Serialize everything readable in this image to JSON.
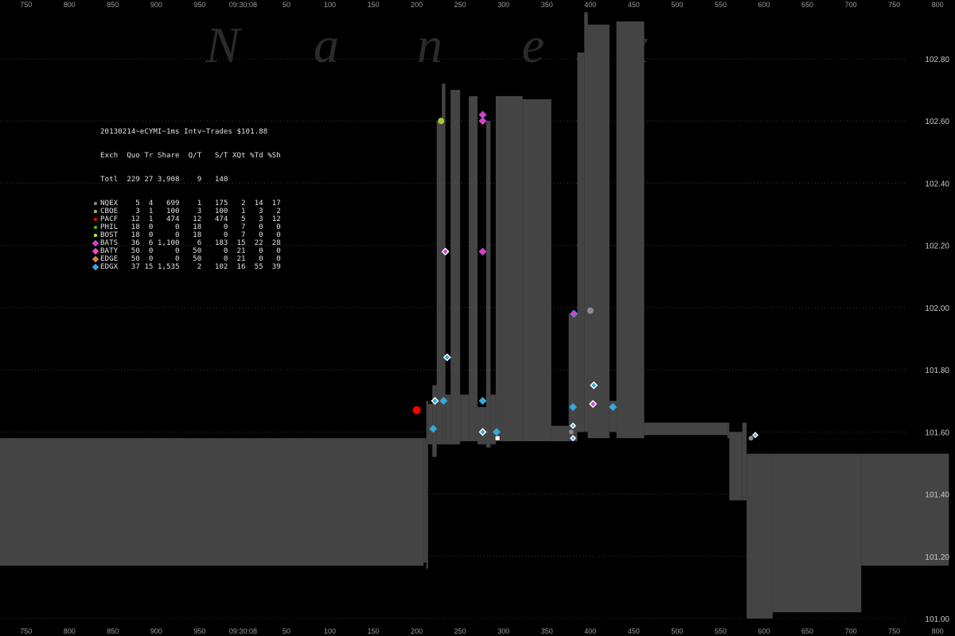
{
  "watermark": "Nanex",
  "chart_data": {
    "type": "area",
    "title": "20130214~eCYMI~1ms Intv~Trades $101.88",
    "ylim": [
      101.0,
      102.92
    ],
    "y_ticks": [
      "102.80",
      "102.60",
      "102.40",
      "102.20",
      "102.00",
      "101.80",
      "101.60",
      "101.40",
      "101.20",
      "101.00"
    ],
    "x_range": [
      720,
      820
    ],
    "x_ticks": [
      "750",
      "800",
      "850",
      "900",
      "950",
      "09:30:08",
      "50",
      "100",
      "150",
      "200",
      "250",
      "300",
      "350",
      "400",
      "450",
      "500",
      "550",
      "600",
      "650",
      "700",
      "750",
      "800"
    ],
    "x_tick_positions": [
      750,
      800,
      850,
      900,
      950,
      1000,
      1050,
      1100,
      1150,
      1200,
      1250,
      1300,
      1350,
      1400,
      1450,
      1500,
      1550,
      1600,
      1650,
      1700,
      1750,
      1800
    ],
    "band": [
      {
        "x0": 720,
        "x1": 1208,
        "low": 101.17,
        "high": 101.58
      },
      {
        "x0": 1208,
        "x1": 1211,
        "low": 101.18,
        "high": 101.58
      },
      {
        "x0": 1211,
        "x1": 1213,
        "low": 101.16,
        "high": 101.7
      },
      {
        "x0": 1213,
        "x1": 1218,
        "low": 101.56,
        "high": 101.69
      },
      {
        "x0": 1218,
        "x1": 1223,
        "low": 101.52,
        "high": 101.75
      },
      {
        "x0": 1223,
        "x1": 1229,
        "low": 101.56,
        "high": 102.6
      },
      {
        "x0": 1229,
        "x1": 1233,
        "low": 101.56,
        "high": 102.72
      },
      {
        "x0": 1233,
        "x1": 1239,
        "low": 101.56,
        "high": 101.72
      },
      {
        "x0": 1239,
        "x1": 1250,
        "low": 101.56,
        "high": 102.7
      },
      {
        "x0": 1250,
        "x1": 1260,
        "low": 101.57,
        "high": 101.72
      },
      {
        "x0": 1260,
        "x1": 1270,
        "low": 101.57,
        "high": 102.68
      },
      {
        "x0": 1270,
        "x1": 1280,
        "low": 101.56,
        "high": 101.68
      },
      {
        "x0": 1280,
        "x1": 1285,
        "low": 101.55,
        "high": 102.6
      },
      {
        "x0": 1285,
        "x1": 1291,
        "low": 101.56,
        "high": 101.72
      },
      {
        "x0": 1291,
        "x1": 1297,
        "low": 101.57,
        "high": 102.68
      },
      {
        "x0": 1297,
        "x1": 1322,
        "low": 101.57,
        "high": 102.68
      },
      {
        "x0": 1322,
        "x1": 1355,
        "low": 101.57,
        "high": 102.67
      },
      {
        "x0": 1355,
        "x1": 1375,
        "low": 101.57,
        "high": 101.62
      },
      {
        "x0": 1375,
        "x1": 1385,
        "low": 101.57,
        "high": 101.98
      },
      {
        "x0": 1385,
        "x1": 1393,
        "low": 101.6,
        "high": 102.82
      },
      {
        "x0": 1393,
        "x1": 1397,
        "low": 101.6,
        "high": 102.95
      },
      {
        "x0": 1397,
        "x1": 1422,
        "low": 101.58,
        "high": 102.91
      },
      {
        "x0": 1422,
        "x1": 1430,
        "low": 101.6,
        "high": 101.7
      },
      {
        "x0": 1430,
        "x1": 1462,
        "low": 101.58,
        "high": 102.92
      },
      {
        "x0": 1462,
        "x1": 1558,
        "low": 101.59,
        "high": 101.63
      },
      {
        "x0": 1558,
        "x1": 1560,
        "low": 101.58,
        "high": 101.63
      },
      {
        "x0": 1560,
        "x1": 1575,
        "low": 101.38,
        "high": 101.6
      },
      {
        "x0": 1575,
        "x1": 1580,
        "low": 101.38,
        "high": 101.63
      },
      {
        "x0": 1580,
        "x1": 1610,
        "low": 101.0,
        "high": 101.53
      },
      {
        "x0": 1610,
        "x1": 1712,
        "low": 101.02,
        "high": 101.53
      },
      {
        "x0": 1712,
        "x1": 1813,
        "low": 101.17,
        "high": 101.53
      }
    ],
    "trades": [
      {
        "exch": "PACF",
        "x": 1200,
        "y": 101.67,
        "shape": "dot",
        "color": "#ff0000",
        "size": 5
      },
      {
        "exch": "CBOE",
        "x": 1228,
        "y": 102.6,
        "shape": "dot",
        "color": "#9acd32",
        "size": 4
      },
      {
        "exch": "BATS",
        "x": 1276,
        "y": 102.62,
        "shape": "diamond",
        "color": "#cc44cc",
        "size": 4
      },
      {
        "exch": "BATS",
        "x": 1276,
        "y": 102.6,
        "shape": "diamond",
        "color": "#cc44cc",
        "size": 4
      },
      {
        "exch": "BATS",
        "x": 1233,
        "y": 102.18,
        "shape": "diamond",
        "color": "#cc44cc",
        "size": 4,
        "outline": true
      },
      {
        "exch": "BATS",
        "x": 1276,
        "y": 102.18,
        "shape": "diamond",
        "color": "#cc44cc",
        "size": 4
      },
      {
        "exch": "EDGX",
        "x": 1381,
        "y": 101.98,
        "shape": "diamond",
        "color": "#33aadd",
        "size": 4
      },
      {
        "exch": "BATS",
        "x": 1381,
        "y": 101.98,
        "shape": "diamond",
        "color": "#cc44cc",
        "size": 3
      },
      {
        "exch": "NQEX",
        "x": 1400,
        "y": 101.99,
        "shape": "dot",
        "color": "#8c8c8c",
        "size": 4
      },
      {
        "exch": "EDGX",
        "x": 1235,
        "y": 101.84,
        "shape": "diamond",
        "color": "#33aadd",
        "size": 4,
        "outline": true
      },
      {
        "exch": "EDGX",
        "x": 1404,
        "y": 101.75,
        "shape": "diamond",
        "color": "#33aadd",
        "size": 4,
        "outline": true
      },
      {
        "exch": "EDGX",
        "x": 1221,
        "y": 101.7,
        "shape": "diamond",
        "color": "#33aadd",
        "size": 4,
        "outline": true
      },
      {
        "exch": "EDGX",
        "x": 1231,
        "y": 101.7,
        "shape": "diamond",
        "color": "#33aadd",
        "size": 4
      },
      {
        "exch": "EDGX",
        "x": 1276,
        "y": 101.7,
        "shape": "diamond",
        "color": "#33aadd",
        "size": 4
      },
      {
        "exch": "EDGX",
        "x": 1380,
        "y": 101.68,
        "shape": "diamond",
        "color": "#33aadd",
        "size": 4
      },
      {
        "exch": "BATS",
        "x": 1403,
        "y": 101.69,
        "shape": "diamond",
        "color": "#cc44cc",
        "size": 4,
        "outline": true
      },
      {
        "exch": "EDGX",
        "x": 1426,
        "y": 101.68,
        "shape": "diamond",
        "color": "#33aadd",
        "size": 4
      },
      {
        "exch": "EDGX",
        "x": 1219,
        "y": 101.61,
        "shape": "diamond",
        "color": "#33aadd",
        "size": 4
      },
      {
        "exch": "EDGX",
        "x": 1276,
        "y": 101.6,
        "shape": "diamond",
        "color": "#33aadd",
        "size": 4,
        "outline": true
      },
      {
        "exch": "EDGX",
        "x": 1292,
        "y": 101.6,
        "shape": "diamond",
        "color": "#33aadd",
        "size": 4
      },
      {
        "exch": "NQEX",
        "x": 1293,
        "y": 101.58,
        "shape": "square",
        "color": "#ffffff",
        "size": 3
      },
      {
        "exch": "EDGX",
        "x": 1380,
        "y": 101.62,
        "shape": "diamond",
        "color": "#33aadd",
        "size": 3,
        "outline": true
      },
      {
        "exch": "NQEX",
        "x": 1378,
        "y": 101.6,
        "shape": "dot",
        "color": "#8c8c8c",
        "size": 3
      },
      {
        "exch": "EDGX",
        "x": 1380,
        "y": 101.58,
        "shape": "diamond",
        "color": "#33aadd",
        "size": 3,
        "outline": true
      },
      {
        "exch": "NQEX",
        "x": 1585,
        "y": 101.58,
        "shape": "dot",
        "color": "#8c8c8c",
        "size": 3
      },
      {
        "exch": "EDGX",
        "x": 1590,
        "y": 101.59,
        "shape": "diamond",
        "color": "#33aadd",
        "size": 3,
        "outline": true
      }
    ],
    "legend": {
      "title": "20130214~eCYMI~1ms Intv~Trades $101.88",
      "header": [
        "Exch",
        "Quo",
        "Tr",
        "Share",
        "Q/T",
        "S/T",
        "XQt",
        "%Td",
        "%Sh"
      ],
      "total": [
        "Totl",
        "229",
        "27",
        "3,908",
        "9",
        "140",
        "",
        "",
        ""
      ],
      "rows": [
        {
          "marker": "dot",
          "color": "#8c8c8c",
          "cells": [
            "NQEX",
            "5",
            "4",
            "699",
            "1",
            "175",
            "2",
            "14",
            "17"
          ]
        },
        {
          "marker": "dot",
          "color": "#9acd32",
          "cells": [
            "CBOE",
            "3",
            "1",
            "100",
            "3",
            "100",
            "1",
            "3",
            "2"
          ]
        },
        {
          "marker": "dot",
          "color": "#ff0000",
          "cells": [
            "PACF",
            "12",
            "1",
            "474",
            "12",
            "474",
            "5",
            "3",
            "12"
          ]
        },
        {
          "marker": "dot",
          "color": "#22cc22",
          "cells": [
            "PHIL",
            "18",
            "0",
            "0",
            "18",
            "0",
            "7",
            "0",
            "0"
          ]
        },
        {
          "marker": "dot",
          "color": "#ccff00",
          "cells": [
            "BOST",
            "18",
            "0",
            "0",
            "18",
            "0",
            "7",
            "0",
            "0"
          ]
        },
        {
          "marker": "diamond",
          "color": "#cc44cc",
          "cells": [
            "BATS",
            "36",
            "6",
            "1,100",
            "6",
            "183",
            "15",
            "22",
            "28"
          ]
        },
        {
          "marker": "diamond",
          "color": "#ff44cc",
          "cells": [
            "BATY",
            "50",
            "0",
            "0",
            "50",
            "0",
            "21",
            "0",
            "0"
          ]
        },
        {
          "marker": "diamond",
          "color": "#cc8833",
          "cells": [
            "EDGE",
            "50",
            "0",
            "0",
            "50",
            "0",
            "21",
            "0",
            "0"
          ]
        },
        {
          "marker": "diamond",
          "color": "#33aadd",
          "cells": [
            "EDGX",
            "37",
            "15",
            "1,535",
            "2",
            "102",
            "16",
            "55",
            "39"
          ]
        }
      ]
    }
  }
}
